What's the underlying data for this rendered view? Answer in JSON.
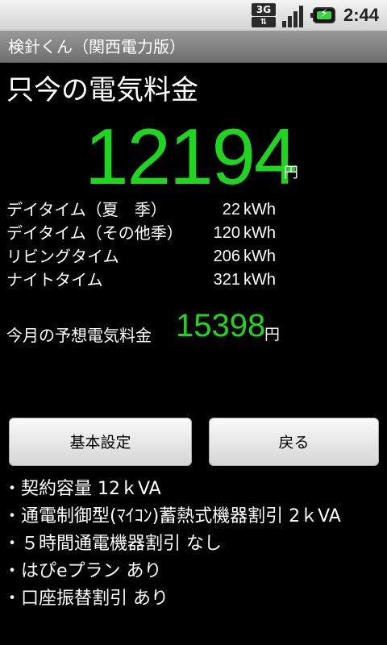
{
  "status_bar": {
    "network_label": "3G",
    "time": "2:44",
    "icons": [
      "3g-data-icon",
      "signal-icon",
      "battery-charging-icon"
    ]
  },
  "app": {
    "title": "検針くん（関西電力版）"
  },
  "main": {
    "heading": "只今の電気料金",
    "current_amount": "12194",
    "current_unit": "円",
    "usage": [
      {
        "label": "デイタイム（夏　季）",
        "value": "22",
        "unit": "kWh"
      },
      {
        "label": "デイタイム（その他季）",
        "value": "120",
        "unit": "kWh"
      },
      {
        "label": "リビングタイム",
        "value": "206",
        "unit": "kWh"
      },
      {
        "label": "ナイトタイム",
        "value": "321",
        "unit": "kWh"
      }
    ],
    "forecast_label": "今月の予想電気料金",
    "forecast_amount": "15398",
    "forecast_unit": "円"
  },
  "buttons": {
    "settings": "基本設定",
    "back": "戻る"
  },
  "options": [
    "・契約容量 12ｋVA",
    "・通電制御型(ﾏｲｺﾝ)蓄熱式機器割引 2ｋVA",
    "・５時間通電機器割引 なし",
    "・はぴeプラン あり",
    "・口座振替割引 あり"
  ],
  "colors": {
    "amount_green": "#1fd51f",
    "background": "#000000"
  }
}
